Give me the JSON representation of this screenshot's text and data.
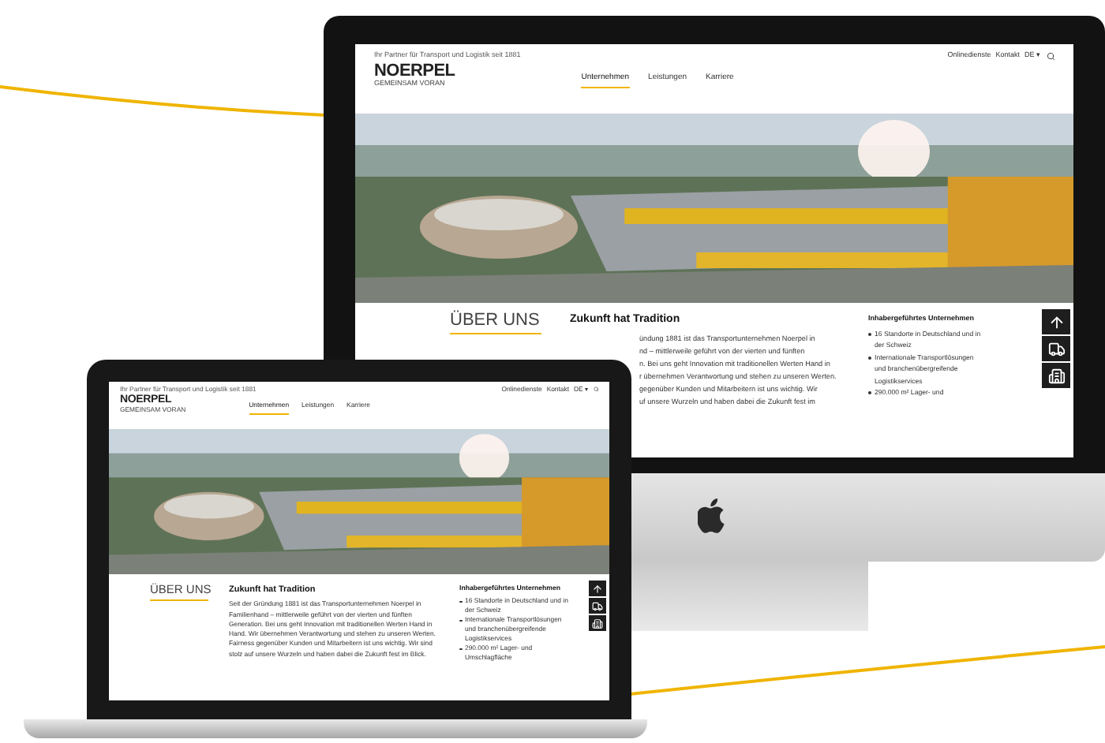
{
  "sites": [
    {
      "kind": "desktop",
      "tagline": "Ihr Partner für Transport und Logistik seit 1881",
      "utility_links": [
        "Onlinedienste",
        "Kontakt",
        "DE ▾"
      ],
      "logo": "NOERPEL",
      "logo_sub": "GEMEINSAM VORAN",
      "nav": [
        {
          "label": "Unternehmen",
          "selected": true
        },
        {
          "label": "Leistungen",
          "selected": false
        },
        {
          "label": "Karriere",
          "selected": false
        }
      ],
      "heading": "ÜBER UNS",
      "title": "Zukunft hat Tradition",
      "paragraph_lines": [
        "ündung 1881 ist das Transportunternehmen Noerpel in",
        "nd – mittlerweile geführt von der vierten und fünften",
        "n. Bei uns geht Innovation mit traditionellen Werten Hand in",
        "r übernehmen Verantwortung und stehen zu unseren Werten.",
        "gegenüber Kunden und Mitarbeitern ist uns wichtig. Wir",
        "uf unsere Wurzeln und haben dabei die Zukunft fest im"
      ],
      "aside_title": "Inhabergeführtes Unternehmen",
      "aside_items": [
        "16 Standorte in Deutschland und in der Schweiz",
        "Internationale Transportlösungen und branchenübergreifende Logistikservices",
        "290.000 m² Lager- und"
      ]
    },
    {
      "kind": "laptop",
      "tagline": "Ihr Partner für Transport und Logistik seit 1881",
      "utility_links": [
        "Onlinedienste",
        "Kontakt",
        "DE ▾"
      ],
      "logo": "NOERPEL",
      "logo_sub": "GEMEINSAM VORAN",
      "nav": [
        {
          "label": "Unternehmen",
          "selected": true
        },
        {
          "label": "Leistungen",
          "selected": false
        },
        {
          "label": "Karriere",
          "selected": false
        }
      ],
      "heading": "ÜBER UNS",
      "title": "Zukunft hat Tradition",
      "paragraph": "Seit der Gründung 1881 ist das Transportunternehmen Noerpel in Familienhand – mittlerweile geführt von der vierten und fünften Generation. Bei uns geht Innovation mit traditionellen Werten Hand in Hand. Wir übernehmen Verantwortung und stehen zu unseren Werten. Fairness gegenüber Kunden und Mitarbeitern ist uns wichtig. Wir sind stolz auf unsere Wurzeln und haben dabei die Zukunft fest im Blick.",
      "aside_title": "Inhabergeführtes Unternehmen",
      "aside_items": [
        "16 Standorte in Deutschland und in der Schweiz",
        "Internationale Transportlösungen und branchenübergreifende Logistikservices",
        "290.000 m² Lager- und Umschlagfläche"
      ]
    }
  ]
}
